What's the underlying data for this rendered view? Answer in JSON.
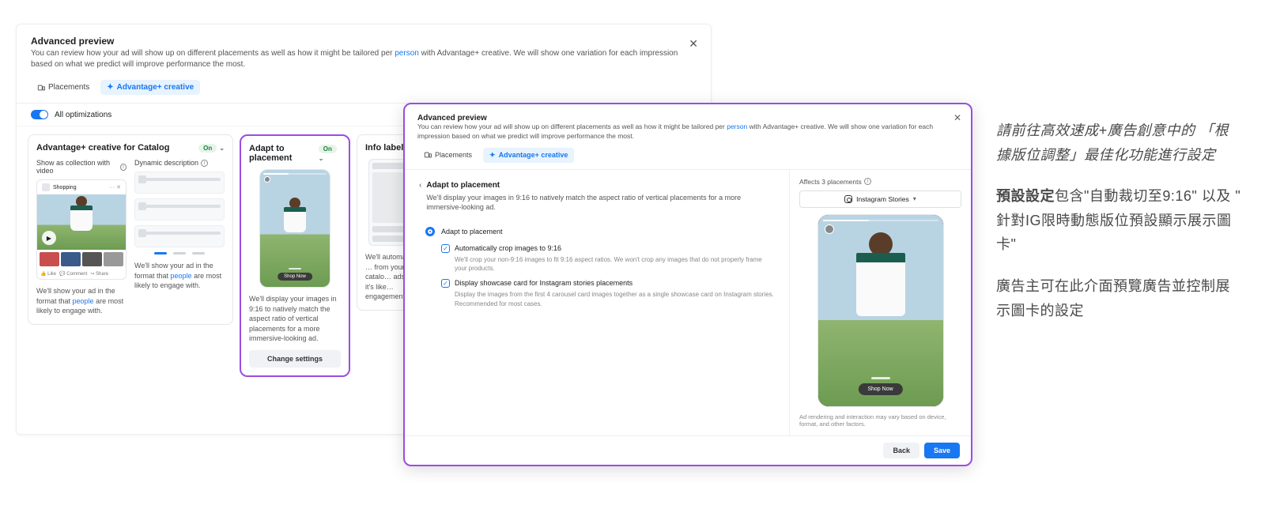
{
  "bg": {
    "title": "Advanced preview",
    "desc1": "You can review how your ad will show up on different placements as well as how it might be tailored per ",
    "desc_link": "person",
    "desc2": " with Advantage+ creative. We will show one variation for each impression based on what we predict will improve performance the most.",
    "tabs": {
      "placements": "Placements",
      "adv": "Advantage+ creative"
    },
    "all_opts": "All optimizations"
  },
  "catalog": {
    "title": "Advantage+ creative for Catalog",
    "pill": "On",
    "col1": "Show as collection with video",
    "col2": "Dynamic description",
    "shopping_tag": "Shopping",
    "like": "Like",
    "comment": "Comment",
    "share": "Share",
    "desc_left1": "We'll show your ad in the format that ",
    "people": "people",
    "desc_left2": " are most likely to engage with.",
    "desc_right": "We'll show your ad in the format that "
  },
  "adapt_card": {
    "title": "Adapt to placement",
    "pill": "On",
    "desc": "We'll display your images in 9:16 to natively match the aspect ratio of vertical placements for a more immersive-looking ad.",
    "change": "Change settings"
  },
  "info_card": {
    "title": "Info labels",
    "desc": "We'll automatically … from your catalo… ads when it's like… engagement."
  },
  "dialog": {
    "title": "Advanced preview",
    "desc1": "You can review how your ad will show up on different placements as well as how it might be tailored per ",
    "desc_link": "person",
    "desc2": " with Advantage+ creative. We will show one variation for each impression based on what we predict will improve performance the most.",
    "section_title": "Adapt to placement",
    "section_sub": "We'll display your images in 9:16 to natively match the aspect ratio of vertical placements for a more immersive-looking ad.",
    "radio": "Adapt to placement",
    "check1_t": "Automatically crop images to 9:16",
    "check1_d": "We'll crop your non-9:16 images to fit 9:16 aspect ratios. We won't crop any images that do not properly frame your products.",
    "check2_t": "Display showcase card for Instagram stories placements",
    "check2_d": "Display the images from the first 4 carousel card images together as a single showcase card on Instagram stories. Recommended for most cases.",
    "affects": "Affects 3 placements",
    "placement": "Instagram Stories",
    "shop": "Shop Now",
    "disclaimer": "Ad rendering and interaction may vary based on device, format, and other factors.",
    "back": "Back",
    "save": "Save"
  },
  "annot": {
    "p1": "請前往高效速成+廣告創意中的 「根據版位調整」最佳化功能進行設定",
    "p2a": "預設設定",
    "p2b": "包含\"自動裁切至9:16\" 以及 \" 針對IG限時動態版位預設顯示展示圖卡\"",
    "p3": "廣告主可在此介面預覽廣告並控制展示圖卡的設定"
  }
}
